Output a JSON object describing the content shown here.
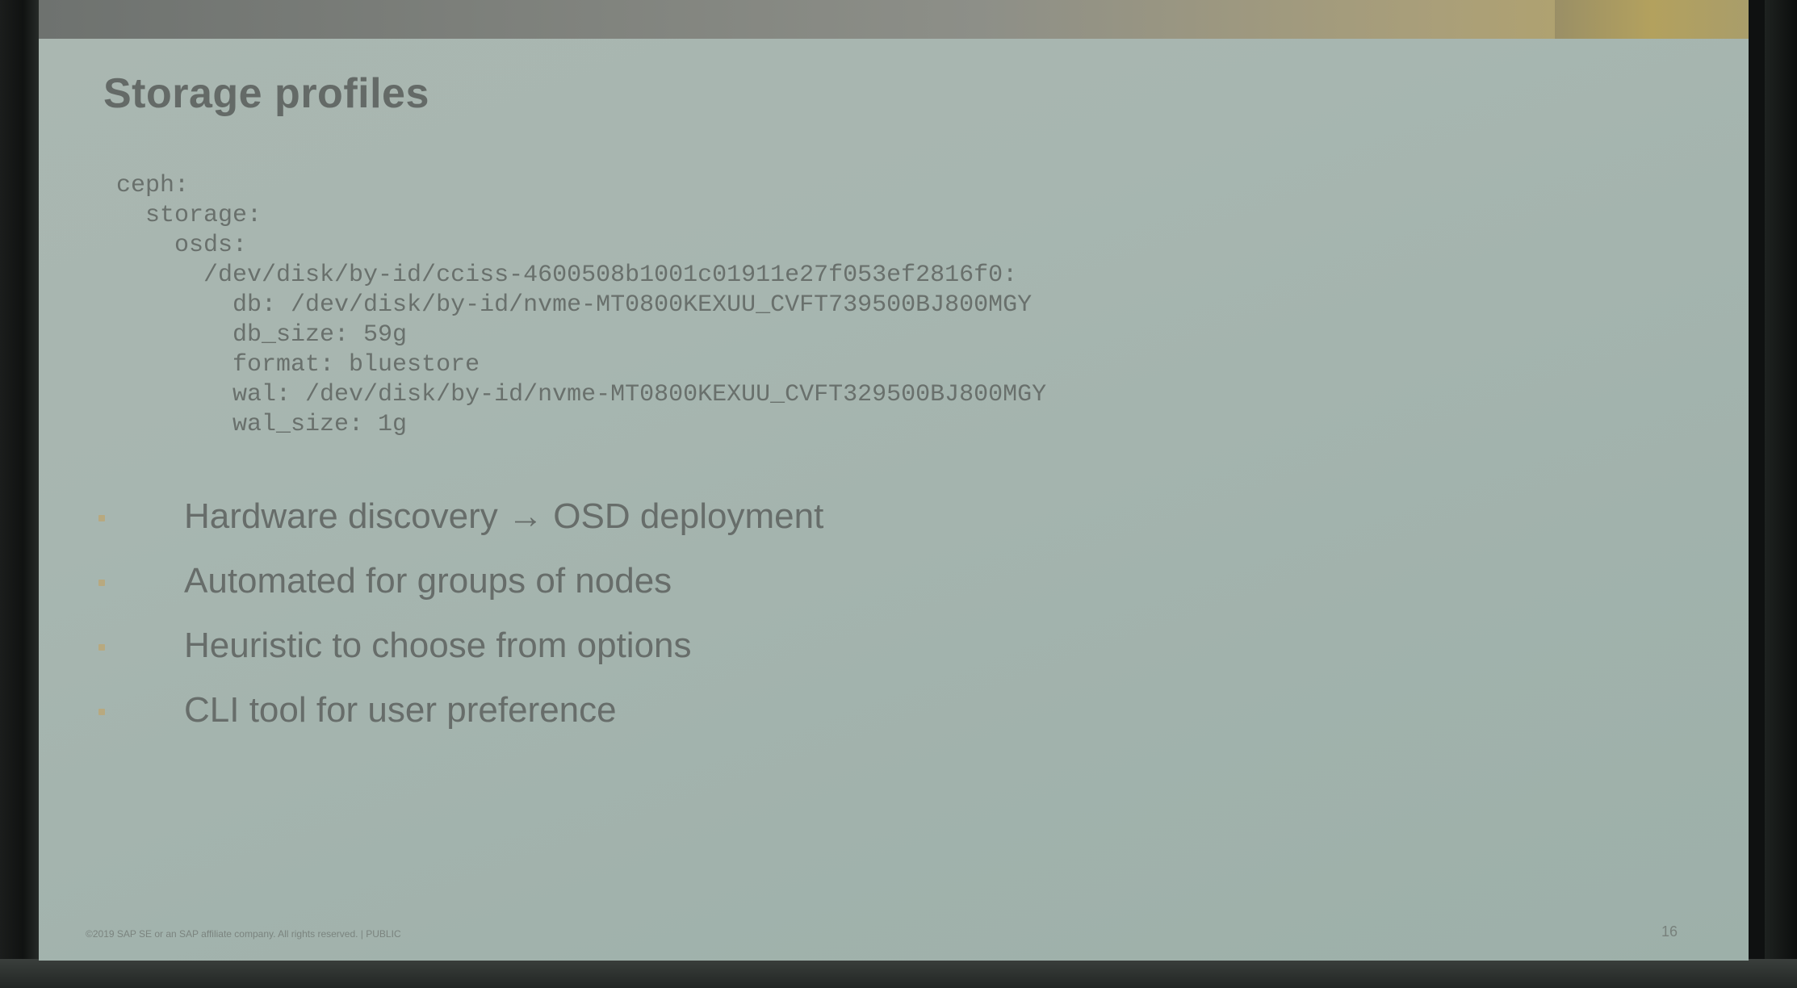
{
  "slide": {
    "title": "Storage profiles",
    "code_lines": [
      "ceph:",
      "  storage:",
      "    osds:",
      "      /dev/disk/by-id/cciss-4600508b1001c01911e27f053ef2816f0:",
      "        db: /dev/disk/by-id/nvme-MT0800KEXUU_CVFT739500BJ800MGY",
      "        db_size: 59g",
      "        format: bluestore",
      "        wal: /dev/disk/by-id/nvme-MT0800KEXUU_CVFT329500BJ800MGY",
      "        wal_size: 1g"
    ],
    "bullets": [
      "Hardware discovery → OSD deployment",
      "Automated for groups of nodes",
      "Heuristic to choose from options",
      "CLI tool for user preference"
    ],
    "footer": "©2019 SAP SE or an SAP affiliate company. All rights reserved.  |  PUBLIC",
    "page_number": "16"
  },
  "colors": {
    "slide_background": "#a7b6b0",
    "text": "#676d6a",
    "accent_gold": "#b8a662"
  }
}
